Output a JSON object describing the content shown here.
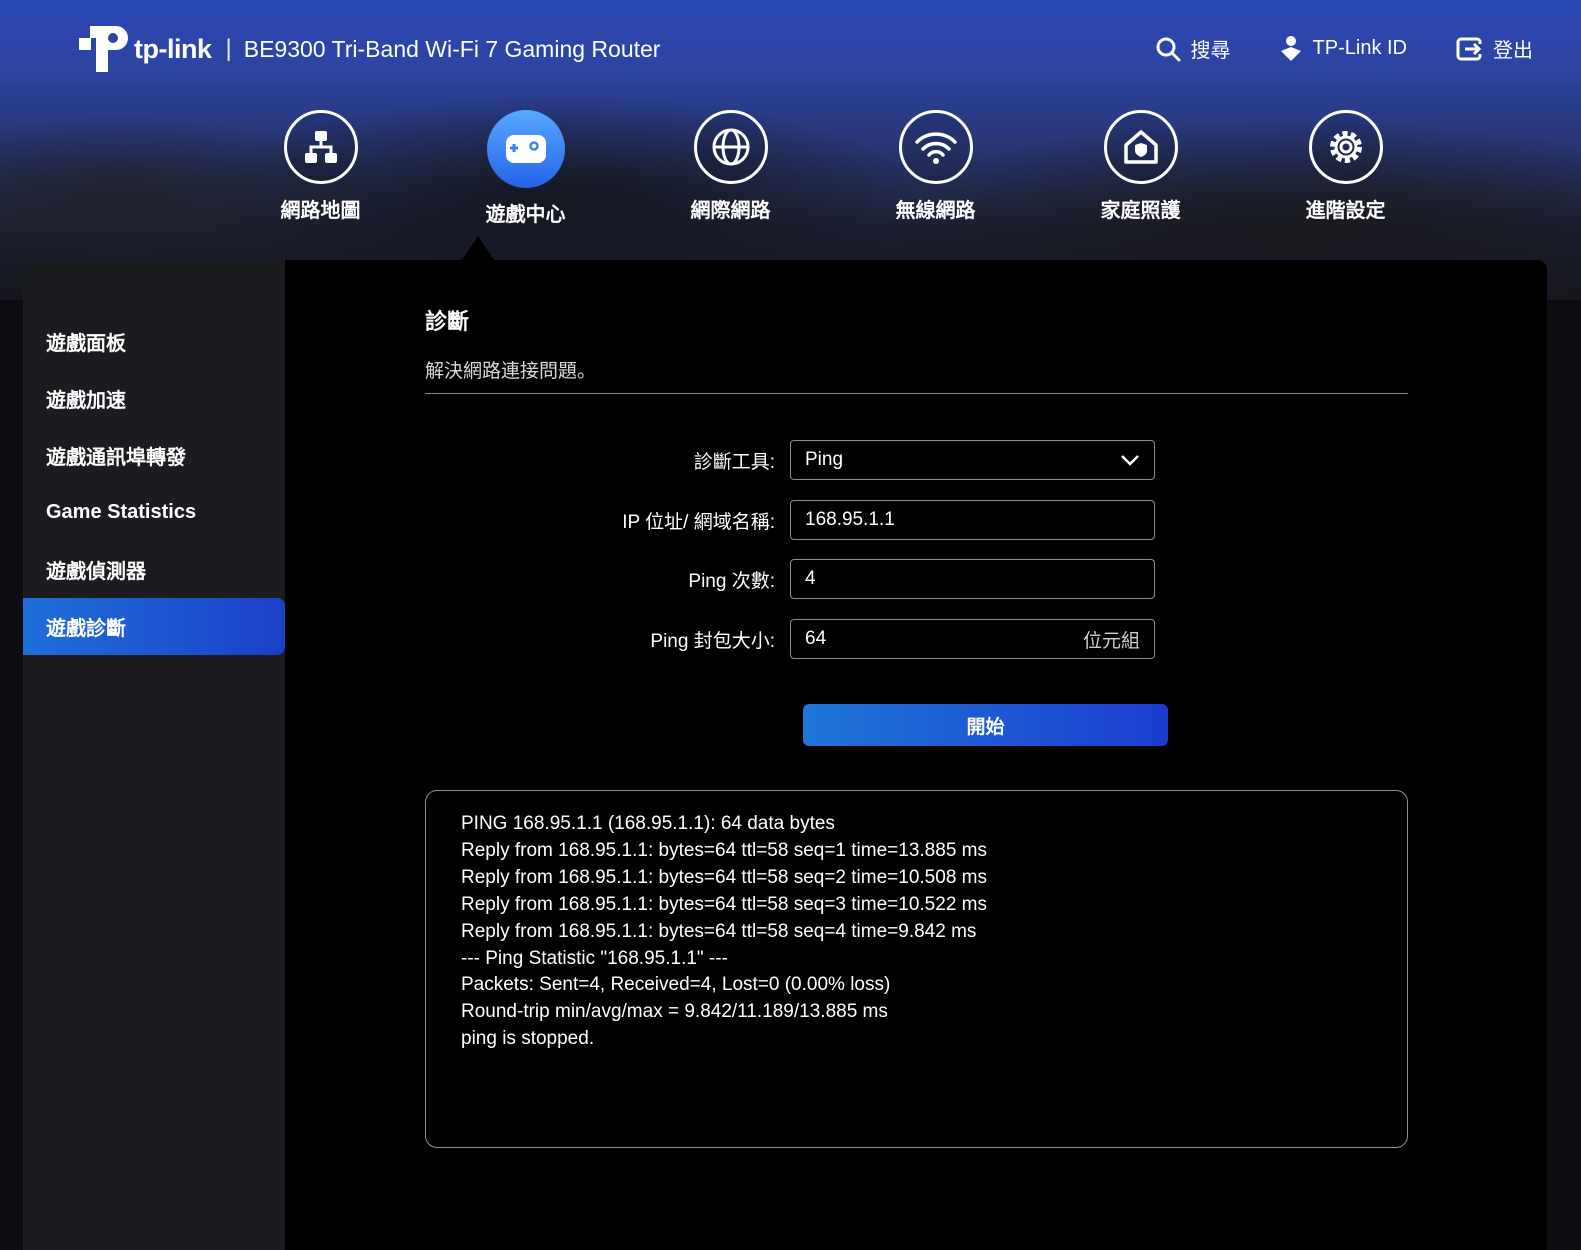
{
  "header": {
    "brand": "tp-link",
    "separator": "|",
    "model": "BE9300 Tri-Band Wi-Fi 7 Gaming Router",
    "actions": [
      {
        "label": "搜尋",
        "icon": "search-icon"
      },
      {
        "label": "TP-Link ID",
        "icon": "tplink-id-icon"
      },
      {
        "label": "登出",
        "icon": "logout-icon"
      }
    ]
  },
  "nav": [
    {
      "label": "網路地圖",
      "icon": "network-map-icon",
      "active": false
    },
    {
      "label": "遊戲中心",
      "icon": "gamepad-icon",
      "active": true
    },
    {
      "label": "網際網路",
      "icon": "globe-icon",
      "active": false
    },
    {
      "label": "無線網路",
      "icon": "wifi-icon",
      "active": false
    },
    {
      "label": "家庭照護",
      "icon": "home-shield-icon",
      "active": false
    },
    {
      "label": "進階設定",
      "icon": "gear-icon",
      "active": false
    }
  ],
  "sidebar": {
    "items": [
      {
        "label": "遊戲面板"
      },
      {
        "label": "遊戲加速"
      },
      {
        "label": "遊戲通訊埠轉發"
      },
      {
        "label": "Game Statistics"
      },
      {
        "label": "遊戲偵測器"
      },
      {
        "label": "遊戲診斷",
        "active": true
      }
    ]
  },
  "main": {
    "title": "診斷",
    "subtitle": "解決網路連接問題。",
    "form": {
      "tool_label": "診斷工具:",
      "tool_value": "Ping",
      "ip_label": "IP 位址/ 網域名稱:",
      "ip_value": "168.95.1.1",
      "count_label": "Ping 次數:",
      "count_value": "4",
      "size_label": "Ping 封包大小:",
      "size_value": "64",
      "size_unit": "位元組",
      "start_label": "開始"
    },
    "output": [
      "PING 168.95.1.1 (168.95.1.1): 64 data bytes",
      "Reply from 168.95.1.1: bytes=64 ttl=58 seq=1 time=13.885 ms",
      "Reply from 168.95.1.1: bytes=64 ttl=58 seq=2 time=10.508 ms",
      "Reply from 168.95.1.1: bytes=64 ttl=58 seq=3 time=10.522 ms",
      "Reply from 168.95.1.1: bytes=64 ttl=58 seq=4 time=9.842 ms",
      "--- Ping Statistic \"168.95.1.1\" ---",
      "Packets: Sent=4, Received=4, Lost=0 (0.00% loss)",
      "Round-trip min/avg/max = 9.842/11.189/13.885 ms",
      "ping is stopped."
    ]
  },
  "colors": {
    "accent": "#1f6fd9",
    "panel_bg": "#000000",
    "sidebar_bg": "#1b1c20"
  }
}
